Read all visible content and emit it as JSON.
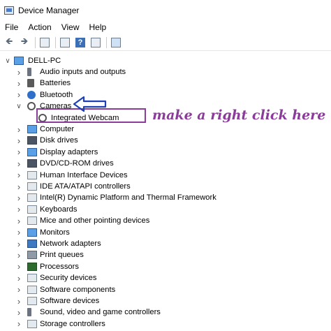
{
  "window": {
    "title": "Device Manager",
    "cut_text_1": "",
    "cut_text_2": ""
  },
  "menu": [
    "File",
    "Action",
    "View",
    "Help"
  ],
  "toolbar_icons": [
    "back-icon",
    "forward-icon",
    "properties-icon",
    "list-icon",
    "help-icon",
    "view-icon",
    "monitor-icon"
  ],
  "tree": {
    "root": "DELL-PC",
    "categories": [
      {
        "label": "Audio inputs and outputs",
        "icon": "speaker-icon"
      },
      {
        "label": "Batteries",
        "icon": "battery-icon"
      },
      {
        "label": "Bluetooth",
        "icon": "bluetooth-icon"
      },
      {
        "label": "Cameras",
        "icon": "camera-icon",
        "expanded": true
      },
      {
        "label": "Integrated Webcam",
        "icon": "webcam-icon",
        "child": true
      },
      {
        "label": "Computer",
        "icon": "computer-icon"
      },
      {
        "label": "Disk drives",
        "icon": "disk-icon"
      },
      {
        "label": "Display adapters",
        "icon": "display-icon"
      },
      {
        "label": "DVD/CD-ROM drives",
        "icon": "dvd-icon"
      },
      {
        "label": "Human Interface Devices",
        "icon": "hid-icon"
      },
      {
        "label": "IDE ATA/ATAPI controllers",
        "icon": "ide-icon"
      },
      {
        "label": "Intel(R) Dynamic Platform and Thermal Framework",
        "icon": "chip-icon"
      },
      {
        "label": "Keyboards",
        "icon": "keyboard-icon"
      },
      {
        "label": "Mice and other pointing devices",
        "icon": "mouse-icon"
      },
      {
        "label": "Monitors",
        "icon": "monitor-icon"
      },
      {
        "label": "Network adapters",
        "icon": "network-icon"
      },
      {
        "label": "Print queues",
        "icon": "printer-icon"
      },
      {
        "label": "Processors",
        "icon": "processor-icon"
      },
      {
        "label": "Security devices",
        "icon": "security-icon"
      },
      {
        "label": "Software components",
        "icon": "software-component-icon"
      },
      {
        "label": "Software devices",
        "icon": "software-device-icon"
      },
      {
        "label": "Sound, video and game controllers",
        "icon": "sound-icon"
      },
      {
        "label": "Storage controllers",
        "icon": "storage-icon"
      }
    ]
  },
  "annotation": {
    "text": "make a right click here",
    "color": "#8b3b9a",
    "arrow_color": "#1f3fb5"
  }
}
